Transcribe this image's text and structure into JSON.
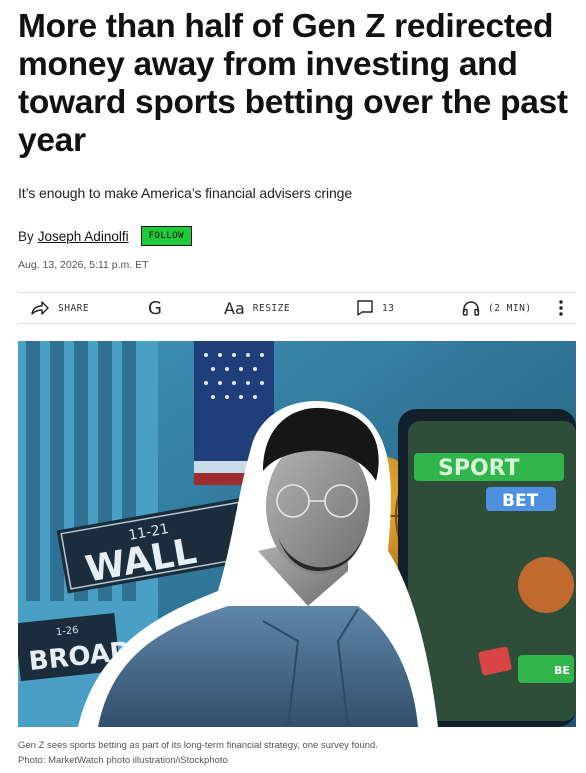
{
  "article": {
    "headline": "More than half of Gen Z redirected money away from investing and toward sports betting over the past year",
    "subhead": "It’s enough to make America’s financial advisers cringe",
    "byline_prefix": "By",
    "author": "Joseph Adinolfi",
    "follow_label": "FOLLOW",
    "timestamp": "Aug. 13, 2026, 5:11 p.m. ET"
  },
  "toolbar": {
    "share_label": "SHARE",
    "google_label": "G",
    "resize_glyph": "Aa",
    "resize_label": "RESIZE",
    "comments_count": "13",
    "listen_label": "(2 MIN)"
  },
  "hero": {
    "sign_wall_number": "11-21",
    "sign_wall_text": "WALL",
    "sign_broad_number": "1-26",
    "sign_broad_text": "BROAD",
    "phone_text_1": "SPORT",
    "phone_text_2": "BET",
    "phone_text_3": "BE"
  },
  "caption": {
    "text": "Gen Z sees sports betting as part of its long-term financial strategy, one survey found.",
    "credit": "Photo: MarketWatch photo illustration/iStockphoto"
  },
  "colors": {
    "follow_green": "#1ecb3a",
    "hero_blue": "#2b6d8c"
  },
  "icons": [
    "share-icon",
    "google-icon",
    "comment-icon",
    "headphones-icon",
    "more-vertical-icon"
  ]
}
